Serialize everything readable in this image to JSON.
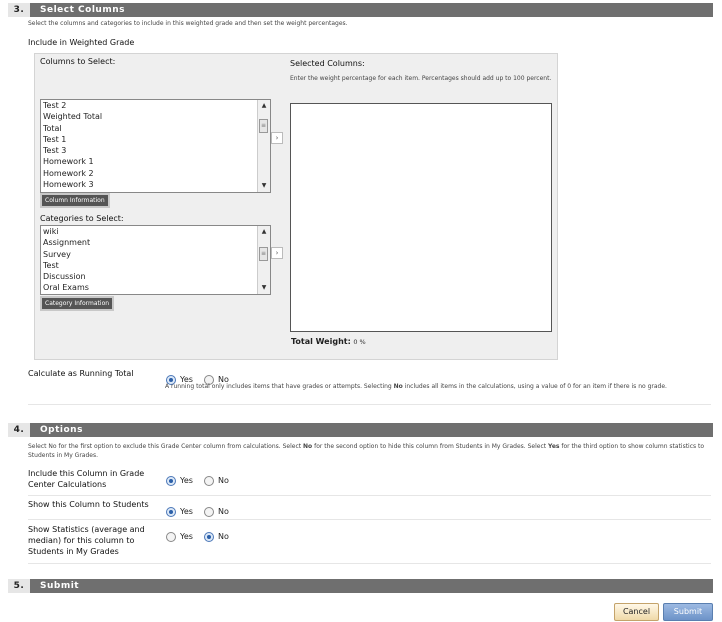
{
  "section3": {
    "number": "3.",
    "title": "Select Columns",
    "help": "Select the columns and categories to include in this weighted grade and then set the weight percentages.",
    "include_label": "Include in Weighted Grade",
    "columns_label": "Columns to Select:",
    "columns": [
      "Test 2",
      "Weighted Total",
      "Total",
      "Test 1",
      "Test 3",
      "Homework 1",
      "Homework 2",
      "Homework 3"
    ],
    "column_info_button": "Column Information",
    "categories_label": "Categories to Select:",
    "categories": [
      "wiki",
      "Assignment",
      "Survey",
      "Test",
      "Discussion",
      "Oral Exams"
    ],
    "category_info_button": "Category Information",
    "selected_label": "Selected Columns:",
    "selected_help": "Enter the weight percentage for each item. Percentages should add up to 100 percent.",
    "total_weight_label": "Total Weight:",
    "total_weight_value": "0 %",
    "running_total_label": "Calculate as Running Total",
    "running_total_help_a": "A running total only includes items that have grades or attempts. Selecting ",
    "running_total_help_b": "No",
    "running_total_help_c": " includes all items in the calculations, using a value of 0 for an item if there is no grade.",
    "running_total_value": "Yes"
  },
  "section4": {
    "number": "4.",
    "title": "Options",
    "help_a": "Select No for the first option to exclude this Grade Center column from calculations. Select ",
    "help_b": "No",
    "help_c": " for the second option to hide this column from Students in My Grades. Select ",
    "help_d": "Yes",
    "help_e": " for the third option to show column statistics to Students in My Grades.",
    "options": [
      {
        "label": "Include this Column in Grade Center Calculations",
        "value": "Yes"
      },
      {
        "label": "Show this Column to Students",
        "value": "Yes"
      },
      {
        "label": "Show Statistics (average and median) for this column to Students in My Grades",
        "value": "No"
      }
    ]
  },
  "radio": {
    "yes": "Yes",
    "no": "No"
  },
  "section5": {
    "number": "5.",
    "title": "Submit"
  },
  "buttons": {
    "cancel": "Cancel",
    "submit": "Submit"
  }
}
